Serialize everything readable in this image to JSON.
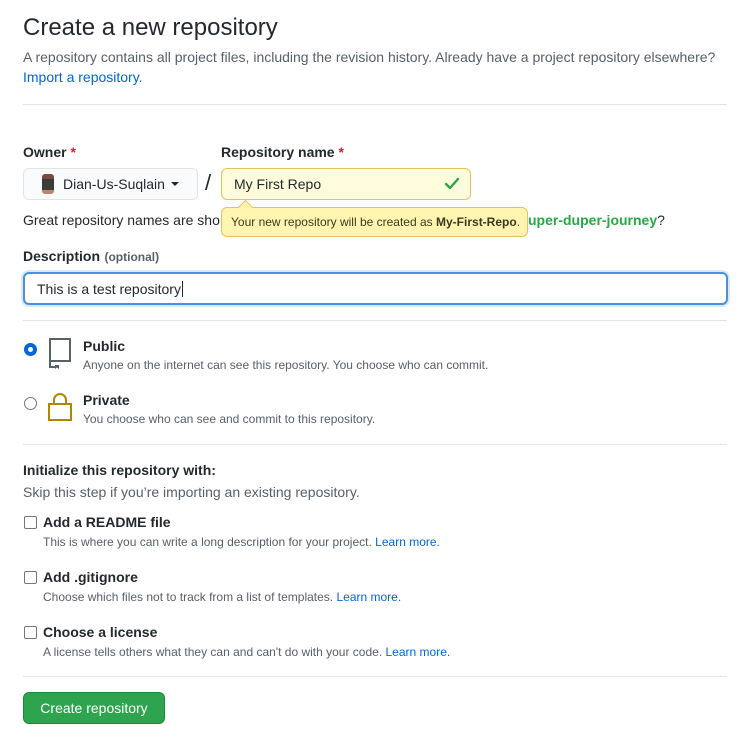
{
  "header": {
    "title": "Create a new repository",
    "subtitle": "A repository contains all project files, including the revision history. Already have a project repository elsewhere?",
    "import_link": "Import a repository."
  },
  "owner": {
    "label": "Owner",
    "required_mark": "*",
    "value": "Dian-Us-Suqlain"
  },
  "separator": "/",
  "repo_name": {
    "label": "Repository name",
    "required_mark": "*",
    "value": "My First Repo",
    "tooltip_prefix": "Your new repository will be created as ",
    "tooltip_name": "My-First-Repo",
    "tooltip_suffix": "."
  },
  "suggestion": {
    "prefix": "Great repository names are sho",
    "suggested_name": "uper-duper-journey",
    "suffix": "?"
  },
  "description": {
    "label": "Description",
    "optional": "(optional)",
    "value": "This is a test repository"
  },
  "visibility": {
    "selected": "public",
    "options": [
      {
        "title": "Public",
        "desc": "Anyone on the internet can see this repository. You choose who can commit."
      },
      {
        "title": "Private",
        "desc": "You choose who can see and commit to this repository."
      }
    ]
  },
  "initialize": {
    "heading": "Initialize this repository with:",
    "hint": "Skip this step if you’re importing an existing repository.",
    "options": [
      {
        "title": "Add a README file",
        "desc": "This is where you can write a long description for your project.",
        "learn": "Learn more."
      },
      {
        "title": "Add .gitignore",
        "desc": "Choose which files not to track from a list of templates.",
        "learn": "Learn more."
      },
      {
        "title": "Choose a license",
        "desc": "A license tells others what they can and can't do with your code.",
        "learn": "Learn more."
      }
    ]
  },
  "submit_label": "Create repository",
  "colors": {
    "primary_green": "#2ea44f",
    "link_blue": "#0366d6",
    "tooltip_yellow": "#fff5b1",
    "private_lock": "#b08800"
  },
  "icons": [
    "check-icon",
    "caret-down-icon",
    "repo-book-icon",
    "lock-icon"
  ]
}
